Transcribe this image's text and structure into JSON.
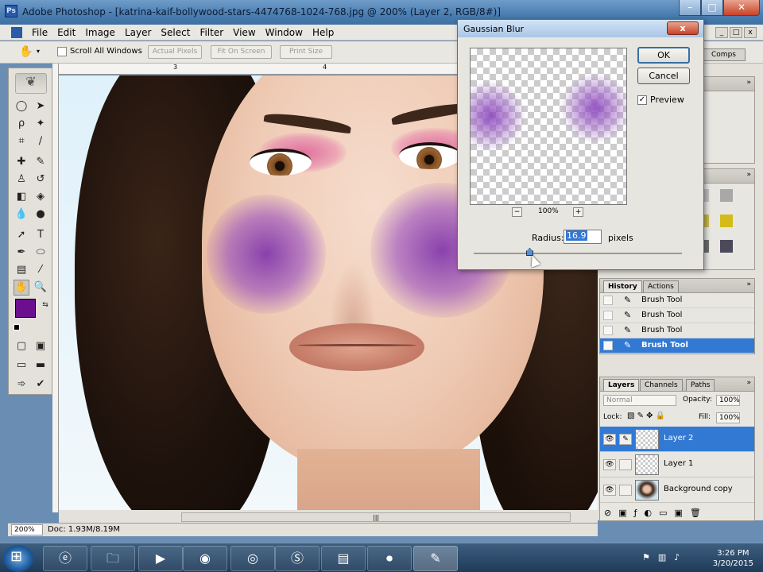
{
  "window": {
    "title": "Adobe Photoshop - [katrina-kaif-bollywood-stars-4474768-1024-768.jpg @ 200% (Layer 2, RGB/8#)]",
    "minimize": "–",
    "maximize": "□",
    "close": "✕"
  },
  "menu": [
    "File",
    "Edit",
    "Image",
    "Layer",
    "Select",
    "Filter",
    "View",
    "Window",
    "Help"
  ],
  "options_bar": {
    "scroll_all_label": "Scroll All Windows",
    "actual_pixels": "Actual Pixels",
    "fit_on_screen": "Fit On Screen",
    "print_size": "Print Size",
    "palette_tab": "Comps"
  },
  "ruler": {
    "marks": [
      "3",
      "4"
    ]
  },
  "dialog": {
    "title": "Gaussian Blur",
    "ok": "OK",
    "cancel": "Cancel",
    "preview_label": "Preview",
    "preview_checked": "✓",
    "zoom": "100%",
    "zoom_out": "−",
    "zoom_in": "+",
    "radius_label": "Radius:",
    "radius_value": "16.9",
    "radius_unit": "pixels",
    "close": "x"
  },
  "history": {
    "tabs": [
      "History",
      "Actions"
    ],
    "items": [
      {
        "label": "Brush Tool"
      },
      {
        "label": "Brush Tool"
      },
      {
        "label": "Brush Tool"
      },
      {
        "label": "Brush Tool",
        "selected": true
      }
    ]
  },
  "layers": {
    "tabs": [
      "Layers",
      "Channels",
      "Paths"
    ],
    "blend_mode": "Normal",
    "opacity_label": "Opacity:",
    "opacity_value": "100%",
    "lock_label": "Lock:",
    "fill_label": "Fill:",
    "fill_value": "100%",
    "items": [
      {
        "name": "Layer 2",
        "selected": true
      },
      {
        "name": "Layer 1",
        "selected": false
      },
      {
        "name": "Background copy",
        "selected": false
      }
    ]
  },
  "status": {
    "zoom": "200%",
    "doc": "Doc: 1.93M/8.19M"
  },
  "taskbar": {
    "time": "3:26 PM",
    "date": "3/20/2015"
  },
  "colors": {
    "foreground": "#6a0f8e",
    "background": "#ffffff",
    "selection": "#3279d3"
  }
}
